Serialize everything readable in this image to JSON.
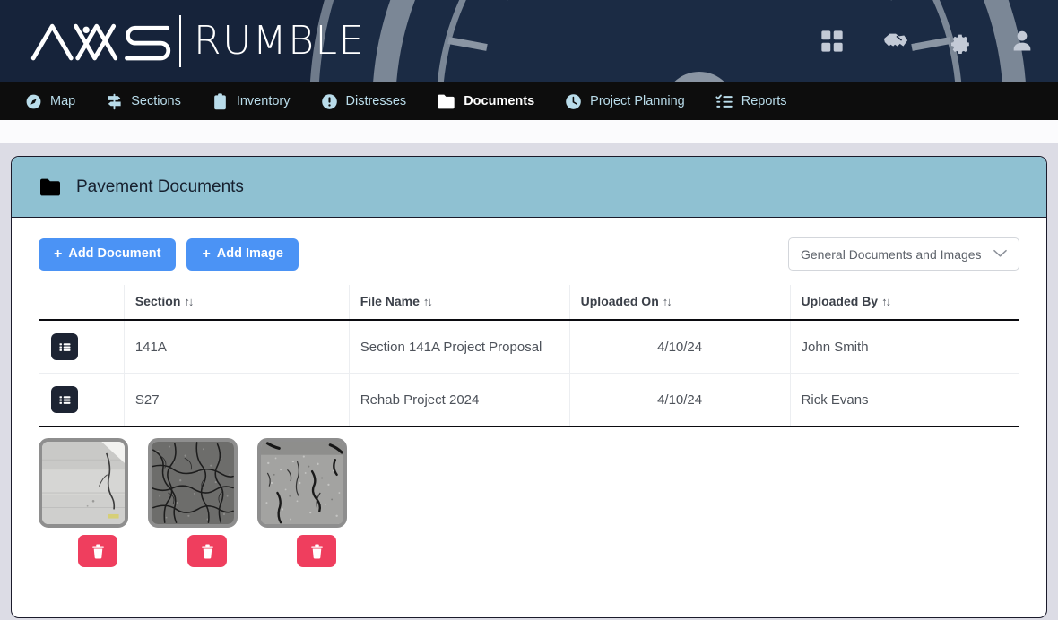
{
  "header": {
    "brand_primary": "AVAS",
    "brand_secondary": "RUMBLE",
    "background_color": "#16233a",
    "icons": [
      {
        "name": "apps-grid-icon",
        "label": "Apps"
      },
      {
        "name": "handshake-icon",
        "label": "Partners"
      },
      {
        "name": "gear-icon",
        "label": "Settings"
      },
      {
        "name": "user-icon",
        "label": "Account"
      }
    ]
  },
  "nav": {
    "background_color": "#0d0d0d",
    "link_color": "#b9dcea",
    "active_color": "#ffffff",
    "items": [
      {
        "label": "Map",
        "icon": "compass-icon",
        "active": false
      },
      {
        "label": "Sections",
        "icon": "signpost-icon",
        "active": false
      },
      {
        "label": "Inventory",
        "icon": "clipboard-icon",
        "active": false
      },
      {
        "label": "Distresses",
        "icon": "alert-circle-icon",
        "active": false
      },
      {
        "label": "Documents",
        "icon": "folder-icon",
        "active": true
      },
      {
        "label": "Project Planning",
        "icon": "clock-icon",
        "active": false
      },
      {
        "label": "Reports",
        "icon": "checklist-icon",
        "active": false
      }
    ]
  },
  "card": {
    "title": "Pavement Documents",
    "title_icon": "folder-icon",
    "header_color": "#8fc1d2"
  },
  "toolbar": {
    "add_document_label": "Add Document",
    "add_image_label": "Add Image",
    "plus_glyph": "+",
    "button_color": "#4b93f5",
    "filter_select": {
      "value": "General Documents and Images",
      "chevron": "chevron-down-icon"
    }
  },
  "table": {
    "sort_glyph": "↑↓",
    "columns": [
      {
        "key": "actions",
        "label": ""
      },
      {
        "key": "section",
        "label": "Section",
        "sortable": true
      },
      {
        "key": "file_name",
        "label": "File Name",
        "sortable": true
      },
      {
        "key": "uploaded_on",
        "label": "Uploaded On",
        "sortable": true
      },
      {
        "key": "uploaded_by",
        "label": "Uploaded By",
        "sortable": true
      }
    ],
    "rows": [
      {
        "action_icon": "list-view-icon",
        "section": "141A",
        "file_name": "Section 141A Project Proposal",
        "uploaded_on": "4/10/24",
        "uploaded_by": "John Smith"
      },
      {
        "action_icon": "list-view-icon",
        "section": "S27",
        "file_name": "Rehab Project 2024",
        "uploaded_on": "4/10/24",
        "uploaded_by": "Rick Evans"
      }
    ]
  },
  "thumbnails": {
    "delete_button_color": "#ef3e5e",
    "delete_icon": "trash-icon",
    "items": [
      {
        "alt": "Concrete pavement with longitudinal crack and white lane line",
        "style": "light-concrete"
      },
      {
        "alt": "Asphalt pavement with alligator cracking",
        "style": "dark-alligator"
      },
      {
        "alt": "Asphalt pavement with block and longitudinal cracking",
        "style": "light-asphalt"
      }
    ]
  }
}
